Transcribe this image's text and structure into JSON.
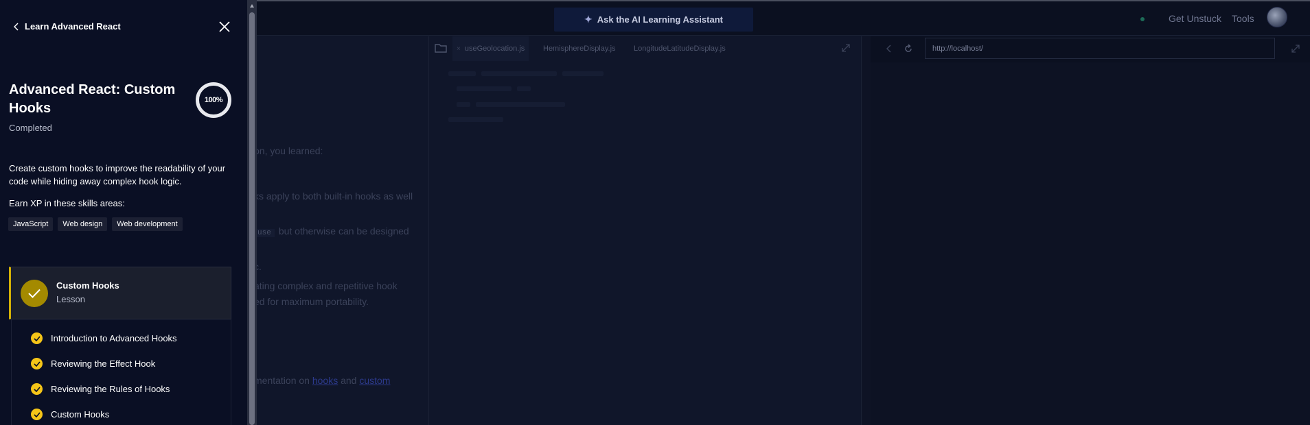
{
  "topbar": {
    "ai_assistant_label": "Ask the AI Learning Assistant",
    "get_unstuck_label": "Get Unstuck",
    "tools_label": "Tools"
  },
  "sidebar": {
    "back_label": "Learn Advanced React",
    "course_title": "Advanced React: Custom Hooks",
    "status": "Completed",
    "progress_label": "100%",
    "progress_value": 1.0,
    "description": "Create custom hooks to improve the readability of your code while hiding away complex hook logic.",
    "xp_label": "Earn XP in these skills areas:",
    "skills": [
      "JavaScript",
      "Web design",
      "Web development"
    ],
    "current_lesson": {
      "name": "Custom Hooks",
      "type": "Lesson"
    },
    "steps": [
      "Introduction to Advanced Hooks",
      "Reviewing the Effect Hook",
      "Reviewing the Rules of Hooks",
      "Custom Hooks"
    ]
  },
  "lesson": {
    "line1": "on, you learned:",
    "line2": "ks apply to both built-in hooks as well",
    "use_chip": "use",
    "line3": "but otherwise can be designed",
    "line4": "c.",
    "line5": "ating complex and repetitive hook",
    "line6": "ed for maximum portability.",
    "line7_prefix": "mentation on ",
    "link_hooks": "hooks",
    "line7_and": " and ",
    "link_custom": "custom"
  },
  "editor": {
    "tabs": [
      "useGeolocation.js",
      "HemisphereDisplay.js",
      "LongitudeLatitudeDisplay.js"
    ]
  },
  "browser": {
    "url": "http://localhost/"
  },
  "colors": {
    "accent_gold": "#d4b106",
    "check_yellow": "#f5c518",
    "sidebar_bg": "#0a0f24"
  }
}
